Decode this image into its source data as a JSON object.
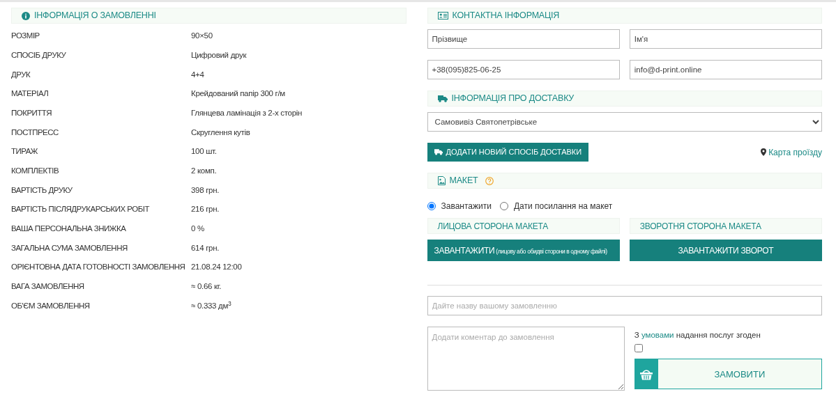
{
  "order_info": {
    "title": "ІНФОРМАЦІЯ О ЗАМОВЛЕННІ",
    "rows": [
      {
        "label": "РОЗМІР",
        "value": "90×50"
      },
      {
        "label": "СПОСІБ ДРУКУ",
        "value": "Цифровий друк"
      },
      {
        "label": "ДРУК",
        "value": "4+4"
      },
      {
        "label": "МАТЕРІАЛ",
        "value": "Крейдований папір 300 г/м"
      },
      {
        "label": "ПОКРИТТЯ",
        "value": "Глянцева ламінація з 2-х сторін"
      },
      {
        "label": "ПОСТПРЕСС",
        "value": "Скруглення кутів"
      },
      {
        "label": "ТИРАЖ",
        "value": "100 шт."
      },
      {
        "label": "КОМПЛЕКТІВ",
        "value": "2 комп."
      },
      {
        "label": "ВАРТІСТЬ ДРУКУ",
        "value": "398 грн."
      },
      {
        "label": "ВАРТІСТЬ ПІСЛЯДРУКАРСЬКИХ РОБІТ",
        "value": "216 грн."
      },
      {
        "label": "ВАША ПЕРСОНАЛЬНА ЗНИЖКА",
        "value": "0 %"
      },
      {
        "label": "ЗАГАЛЬНА СУМА ЗАМОВЛЕННЯ",
        "value": "614 грн."
      },
      {
        "label": "ОРІЄНТОВНА ДАТА ГОТОВНОСТІ ЗАМОВЛЕННЯ",
        "value": "21.08.24 12:00"
      },
      {
        "label": "ВАГА ЗАМОВЛЕННЯ",
        "value": "≈ 0.66 кг."
      },
      {
        "label": "ОБ'ЄМ ЗАМОВЛЕННЯ",
        "value": "≈ 0.333 дм$^{3}$"
      }
    ]
  },
  "contact": {
    "title": "КОНТАКТНА ІНФОРМАЦІЯ",
    "fields": [
      {
        "value": "Прізвище"
      },
      {
        "value": "Ім'я"
      },
      {
        "value": "+38(095)825-06-25"
      },
      {
        "value": "info@d-print.online"
      }
    ]
  },
  "delivery": {
    "title": "ІНФОРМАЦІЯ ПРО ДОСТАВКУ",
    "select": "Самовивіз Святопетрівське",
    "add_button": "ДОДАТИ НОВИЙ СПОСІБ ДОСТАВКИ",
    "map_link": "Карта проїзду"
  },
  "layout": {
    "title": "МАКЕТ",
    "options": [
      {
        "label": "Завантажити",
        "selected": true
      },
      {
        "label": "Дати посилання на макет",
        "selected": false
      }
    ],
    "sides": [
      {
        "title": "ЛИЦОВА СТОРОНА МАКЕТА",
        "button": "ЗАВАНТАЖИТИ",
        "button_note": "(лицову або обидві сторони в одному файлі)"
      },
      {
        "title": "ЗВОРОТНЯ СТОРОНА МАКЕТА",
        "button": "ЗАВАНТАЖИТИ ЗВОРОТ"
      }
    ]
  },
  "order_name": {
    "placeholder": "Дайте назву вашому замовленню"
  },
  "comment": {
    "placeholder": "Додати коментар до замовлення"
  },
  "terms": {
    "before": "З",
    "link": "умовами",
    "after": "надання послуг згоден",
    "checked": false
  },
  "order_button": "ЗАМОВИТИ"
}
